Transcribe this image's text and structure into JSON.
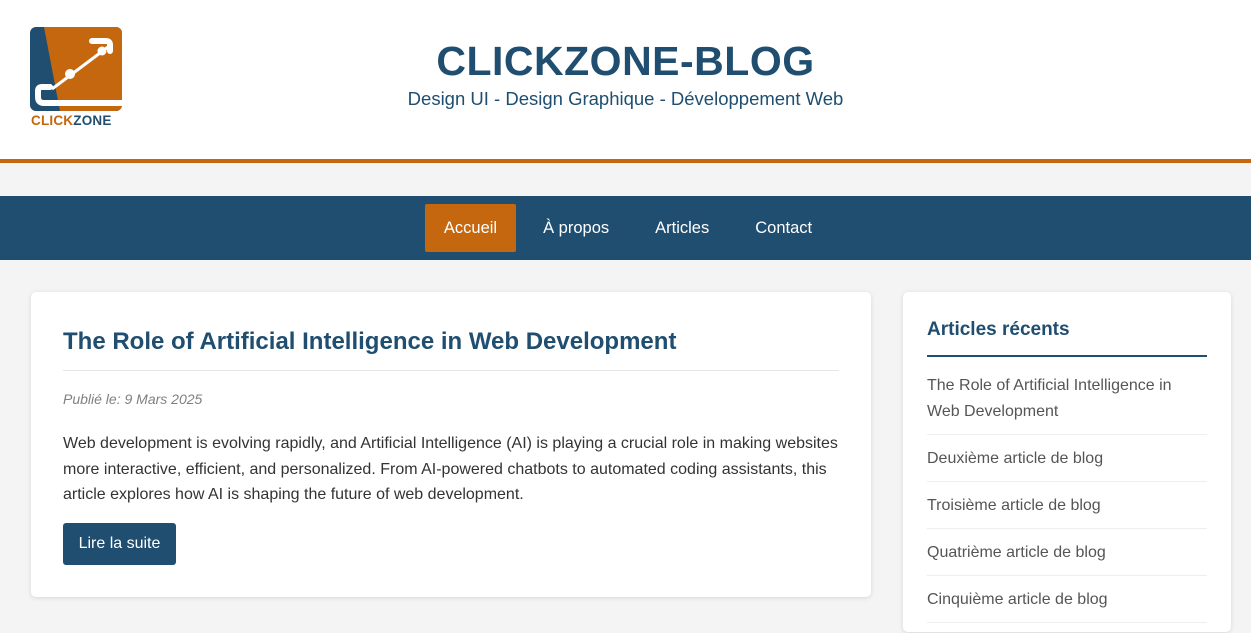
{
  "header": {
    "logo_text_part1": "CLICK",
    "logo_text_part2": "ZONE",
    "title": "CLICKZONE-BLOG",
    "subtitle": "Design UI - Design Graphique - Développement Web"
  },
  "nav": {
    "items": [
      {
        "label": "Accueil",
        "active": true
      },
      {
        "label": "À propos",
        "active": false
      },
      {
        "label": "Articles",
        "active": false
      },
      {
        "label": "Contact",
        "active": false
      }
    ]
  },
  "article": {
    "title": "The Role of Artificial Intelligence in Web Development",
    "date": "Publié le: 9 Mars 2025",
    "excerpt": "Web development is evolving rapidly, and Artificial Intelligence (AI) is playing a crucial role in making websites more interactive, efficient, and personalized. From AI-powered chatbots to automated coding assistants, this article explores how AI is shaping the future of web development.",
    "read_more_label": "Lire la suite"
  },
  "sidebar": {
    "title": "Articles récents",
    "items": [
      {
        "label": "The Role of Artificial Intelligence in Web Development"
      },
      {
        "label": "Deuxième article de blog"
      },
      {
        "label": "Troisième article de blog"
      },
      {
        "label": "Quatrième article de blog"
      },
      {
        "label": "Cinquième article de blog"
      }
    ]
  },
  "colors": {
    "brand_blue": "#1f4e70",
    "brand_orange": "#c4670f"
  },
  "icons": {
    "logo": "clickzone-logo-icon"
  }
}
